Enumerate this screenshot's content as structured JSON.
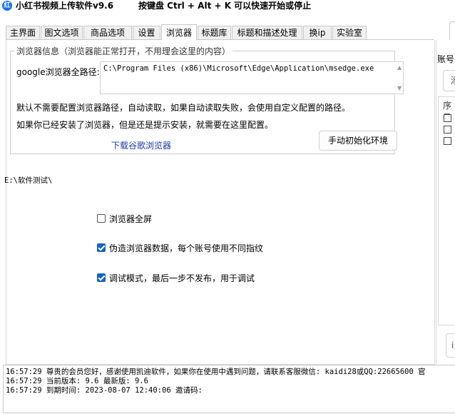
{
  "window": {
    "icon_text": "红",
    "title": "小红书视频上传软件v9.6",
    "hotkey_hint": "按键盘 Ctrl + Alt + K  可以快速开始或停止"
  },
  "tabs": [
    {
      "label": "主界面",
      "active": false
    },
    {
      "label": "图文选项",
      "active": false
    },
    {
      "label": "商品选项",
      "active": false
    },
    {
      "label": "设置",
      "active": false
    },
    {
      "label": "浏览器",
      "active": true
    },
    {
      "label": "标题库",
      "active": false
    },
    {
      "label": "标题和描述处理",
      "active": false
    },
    {
      "label": "换ip",
      "active": false
    },
    {
      "label": "实验室",
      "active": false
    }
  ],
  "browser_group": {
    "legend": "浏览器信息（浏览器能正常打开，不用理会这里的内容）",
    "path_label": "google浏览器全路径:",
    "path_value": "C:\\Program Files (x86)\\Microsoft\\Edge\\Application\\msedge.exe",
    "note1": "默认不需要配置浏览器路径，自动读取，如果自动读取失败，会使用自定义配置的路径。",
    "note2": "如果你已经安装了浏览器，但是还是提示安装，就需要在这里配置。",
    "download_link": "下载谷歌浏览器",
    "init_button": "手动初始化环境"
  },
  "software_path": "E:\\软件测试\\",
  "options": [
    {
      "label": "浏览器全屏",
      "checked": false
    },
    {
      "label": "伪造浏览器数据，每个账号使用不同指纹",
      "checked": true
    },
    {
      "label": "调试模式，最后一步不发布，用于调试",
      "checked": true
    }
  ],
  "right_panel": {
    "account_label": "账号",
    "button_partial": "添",
    "list_header": "序号",
    "bottom_button_partial": "i"
  },
  "log": [
    "16:57:29 尊贵的会员您好，感谢使用凯迪软件，如果你在使用中遇到问题，请联系客服微信: kaidi28或QQ:22665600 官",
    "16:57:29 当前版本: 9.6   最新版: 9.6",
    "16:57:29 到期时间: 2023-08-07 12:40:06 邀请码:"
  ],
  "colors": {
    "accent": "#1565c0",
    "link": "#1c3aa6"
  }
}
